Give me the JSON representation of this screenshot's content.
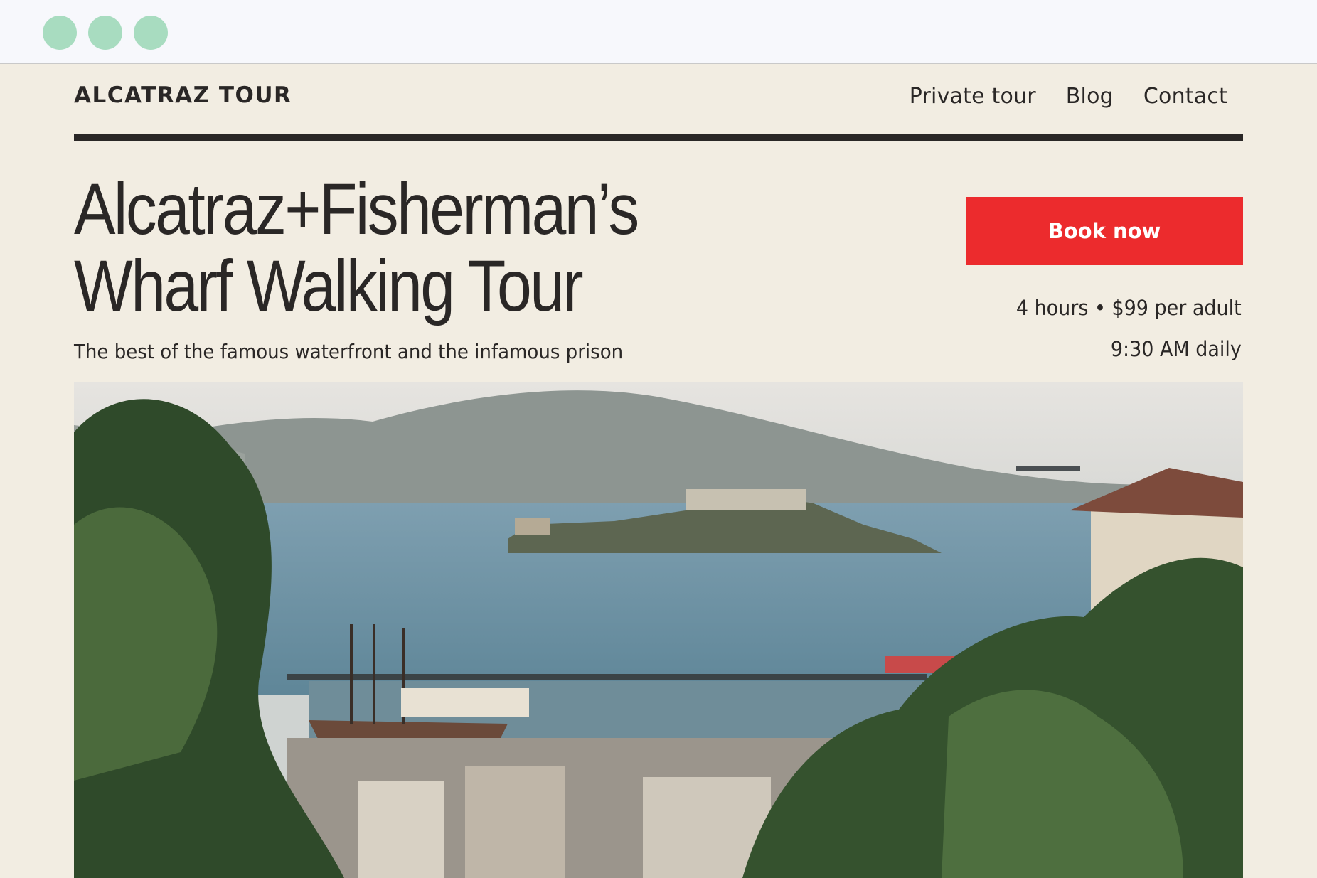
{
  "browser": {
    "window_controls": [
      "close-dot",
      "minimize-dot",
      "maximize-dot"
    ],
    "dot_color": "#a8dcc0"
  },
  "header": {
    "logo": "ALCATRAZ TOUR",
    "nav": [
      {
        "label": "Private tour"
      },
      {
        "label": "Blog"
      },
      {
        "label": "Contact"
      }
    ]
  },
  "hero": {
    "title_line1": "Alcatraz+Fisherman’s",
    "title_line2": "Wharf Walking Tour",
    "subtitle": "The best of the famous waterfront and the infamous prison",
    "book_button": "Book now",
    "duration_price": "4 hours • $99 per adult",
    "schedule": "9:30 AM daily"
  },
  "colors": {
    "background": "#f2ede2",
    "text": "#2a2726",
    "accent": "#ec2b2d"
  },
  "image": {
    "subject": "alcatraz-island-and-fishermans-wharf-photo"
  }
}
